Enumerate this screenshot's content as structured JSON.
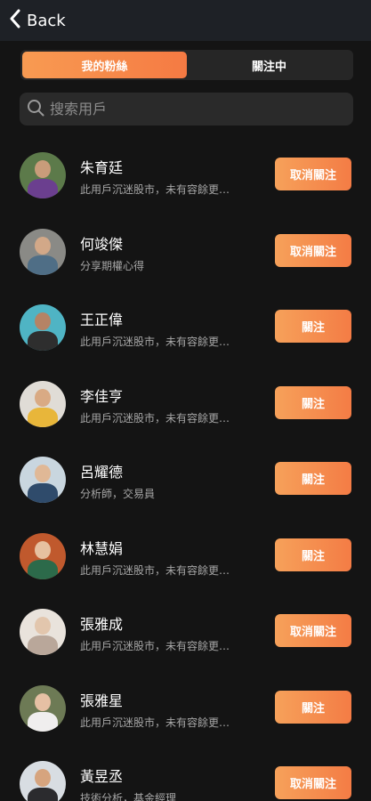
{
  "header": {
    "back_label": "Back"
  },
  "tabs": [
    {
      "label": "我的粉絲",
      "active": true
    },
    {
      "label": "關注中",
      "active": false
    }
  ],
  "search": {
    "placeholder": "搜索用戶",
    "value": ""
  },
  "users": [
    {
      "name": "朱育廷",
      "desc": "此用戶沉迷股市，未有容餘更…",
      "action": "取消關注",
      "avatar_bg": "#5c7a4a",
      "avatar_skin": "#c99c7a",
      "avatar_cloth": "#6b3f8f"
    },
    {
      "name": "何竣傑",
      "desc": "分享期權心得",
      "action": "取消關注",
      "avatar_bg": "#8a8a86",
      "avatar_skin": "#d2a888",
      "avatar_cloth": "#4f6e86"
    },
    {
      "name": "王正偉",
      "desc": "此用戶沉迷股市，未有容餘更…",
      "action": "關注",
      "avatar_bg": "#4fb4c4",
      "avatar_skin": "#b58365",
      "avatar_cloth": "#2e2e2e"
    },
    {
      "name": "李佳亨",
      "desc": "此用戶沉迷股市，未有容餘更…",
      "action": "關注",
      "avatar_bg": "#e0dcd6",
      "avatar_skin": "#d9aa84",
      "avatar_cloth": "#e8b63a"
    },
    {
      "name": "呂耀德",
      "desc": "分析師，交易員",
      "action": "關注",
      "avatar_bg": "#c9d6df",
      "avatar_skin": "#e0b896",
      "avatar_cloth": "#2f4b6b"
    },
    {
      "name": "林慧娟",
      "desc": "此用戶沉迷股市，未有容餘更…",
      "action": "關注",
      "avatar_bg": "#c0592d",
      "avatar_skin": "#e6c1a0",
      "avatar_cloth": "#2c6a4a"
    },
    {
      "name": "張雅成",
      "desc": "此用戶沉迷股市，未有容餘更…",
      "action": "取消關注",
      "avatar_bg": "#e9e3dc",
      "avatar_skin": "#e2c6ad",
      "avatar_cloth": "#b9a79a"
    },
    {
      "name": "張雅星",
      "desc": "此用戶沉迷股市，未有容餘更…",
      "action": "關注",
      "avatar_bg": "#6d7a55",
      "avatar_skin": "#e6c0a4",
      "avatar_cloth": "#f0eeee"
    },
    {
      "name": "黃昱丞",
      "desc": "技術分析，基金經理",
      "action": "取消關注",
      "avatar_bg": "#d8dde2",
      "avatar_skin": "#d6a47e",
      "avatar_cloth": "#2b2b2e"
    }
  ]
}
